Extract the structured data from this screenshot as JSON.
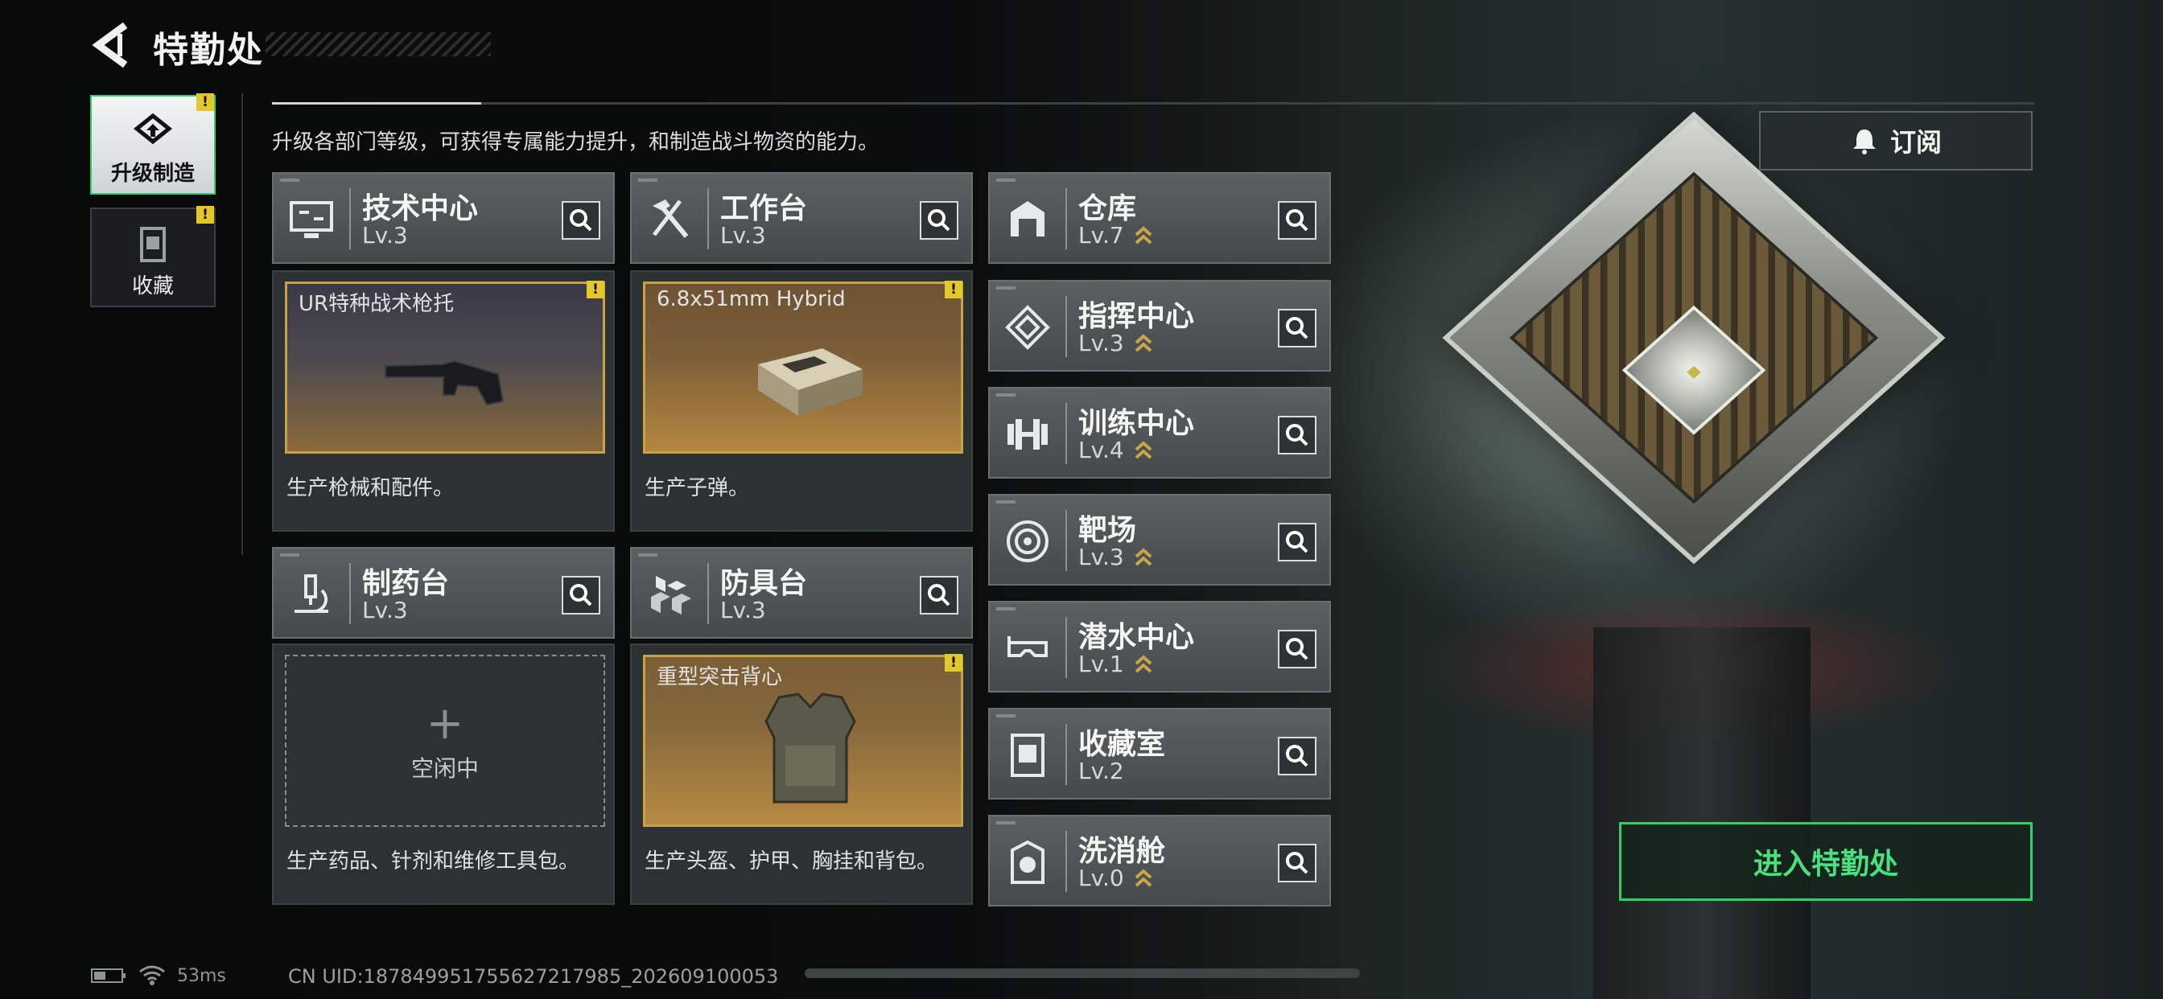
{
  "header": {
    "title": "特勤处"
  },
  "sidebar": {
    "tabs": [
      {
        "label": "升级制造",
        "icon": "upgrade-icon",
        "active": true,
        "badge": "!"
      },
      {
        "label": "收藏",
        "icon": "collection-icon",
        "active": false,
        "badge": "!"
      }
    ]
  },
  "main": {
    "description": "升级各部门等级，可获得专属能力提升，和制造战斗物资的能力。",
    "subscribe_label": "订阅",
    "enter_label": "进入特勤处",
    "production_depts": [
      {
        "name": "技术中心",
        "level": "Lv.3",
        "icon": "monitor-icon",
        "item": {
          "name": "UR特种战术枪托",
          "badge": "!"
        },
        "desc": "生产枪械和配件。"
      },
      {
        "name": "工作台",
        "level": "Lv.3",
        "icon": "hammer-icon",
        "item": {
          "name": "6.8x51mm Hybrid",
          "badge": "!"
        },
        "desc": "生产子弹。"
      },
      {
        "name": "制药台",
        "level": "Lv.3",
        "icon": "microscope-icon",
        "item": {
          "idle": "空闲中"
        },
        "desc": "生产药品、针剂和维修工具包。"
      },
      {
        "name": "防具台",
        "level": "Lv.3",
        "icon": "blocks-icon",
        "item": {
          "name": "重型突击背心",
          "badge": "!"
        },
        "desc": "生产头盔、护甲、胸挂和背包。"
      }
    ],
    "other_depts": [
      {
        "name": "仓库",
        "level": "Lv.7",
        "icon": "warehouse-icon",
        "upgradable": true
      },
      {
        "name": "指挥中心",
        "level": "Lv.3",
        "icon": "command-icon",
        "upgradable": true
      },
      {
        "name": "训练中心",
        "level": "Lv.4",
        "icon": "dumbbell-icon",
        "upgradable": true
      },
      {
        "name": "靶场",
        "level": "Lv.3",
        "icon": "target-icon",
        "upgradable": true
      },
      {
        "name": "潜水中心",
        "level": "Lv.1",
        "icon": "goggles-icon",
        "upgradable": true
      },
      {
        "name": "收藏室",
        "level": "Lv.2",
        "icon": "collection-room-icon",
        "upgradable": false
      },
      {
        "name": "洗消舱",
        "level": "Lv.0",
        "icon": "decon-icon",
        "upgradable": true
      }
    ]
  },
  "status_bar": {
    "ping": "53ms",
    "uid": "CN UID:18784995175562​7217985_202609100053"
  }
}
